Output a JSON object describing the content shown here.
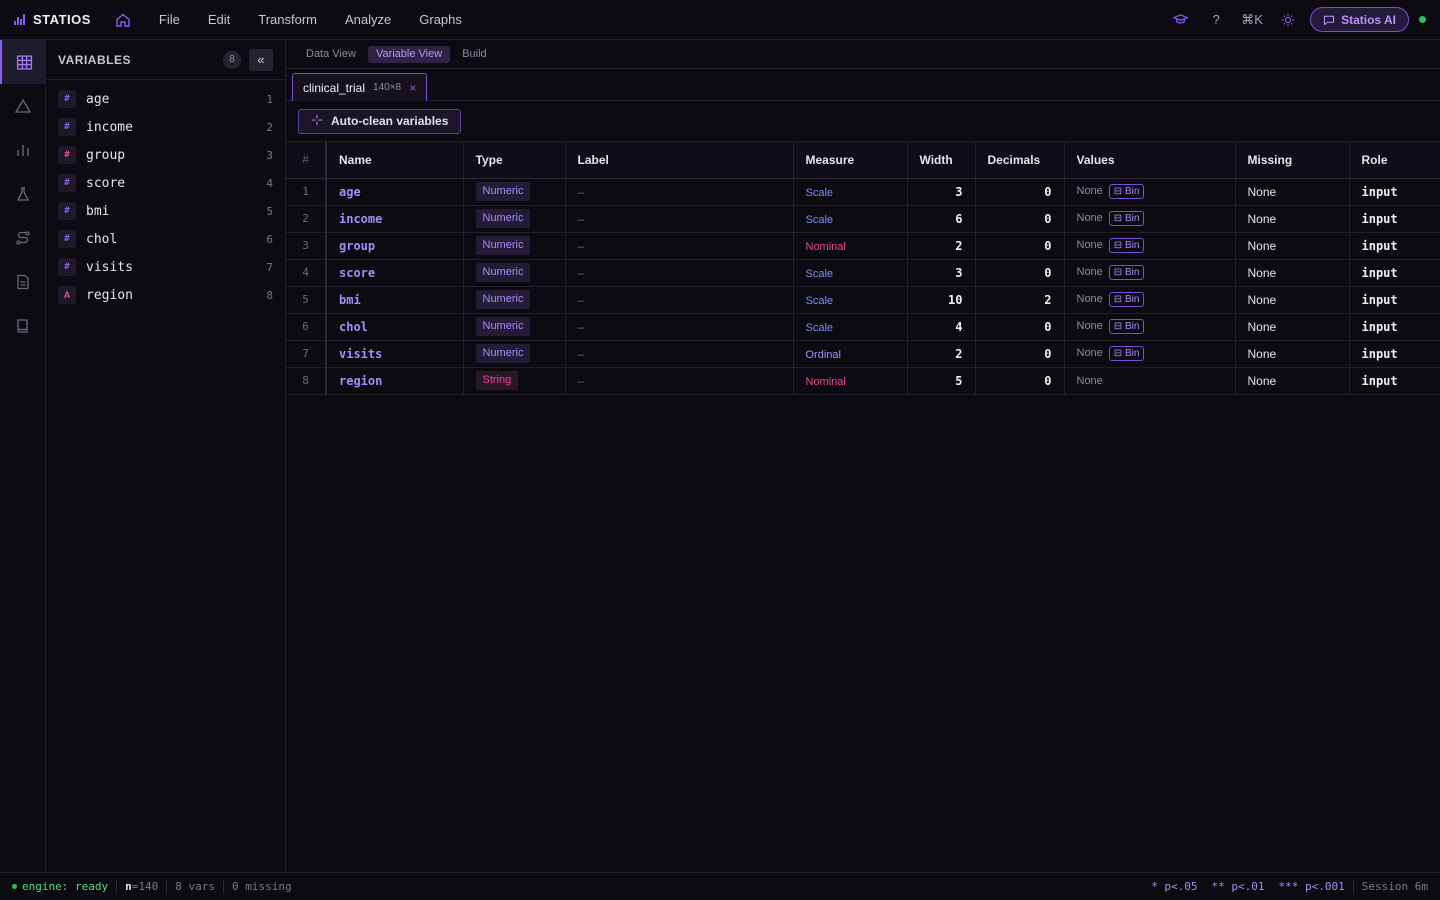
{
  "app": {
    "name": "STATIOS",
    "menu": [
      "File",
      "Edit",
      "Transform",
      "Analyze",
      "Graphs"
    ],
    "shortcut": "⌘K",
    "ai_button": "Statios AI",
    "accent": "#8b5cf6"
  },
  "rail": {
    "icons": [
      "table-icon",
      "triangle-icon",
      "bar-chart-icon",
      "flask-icon",
      "route-icon",
      "document-icon",
      "book-icon"
    ]
  },
  "sidebar": {
    "title": "VARIABLES",
    "count": "8",
    "collapse_label": "«",
    "items": [
      {
        "type": "#",
        "name": "age",
        "index": "1"
      },
      {
        "type": "#",
        "name": "income",
        "index": "2"
      },
      {
        "type": "#",
        "name": "group",
        "index": "3"
      },
      {
        "type": "#",
        "name": "score",
        "index": "4"
      },
      {
        "type": "#",
        "name": "bmi",
        "index": "5"
      },
      {
        "type": "#",
        "name": "chol",
        "index": "6"
      },
      {
        "type": "#",
        "name": "visits",
        "index": "7"
      },
      {
        "type": "A",
        "name": "region",
        "index": "8"
      }
    ]
  },
  "viewtabs": [
    "Data View",
    "Variable View",
    "Build"
  ],
  "filetab": {
    "name": "clinical_trial",
    "dims": "140×8",
    "close": "×"
  },
  "actions": {
    "autoclean": "Auto-clean variables"
  },
  "table": {
    "headers": [
      "#",
      "Name",
      "Type",
      "Label",
      "Measure",
      "Width",
      "Decimals",
      "Values",
      "Missing",
      "Role"
    ],
    "bin_label": "Bin",
    "rows": [
      {
        "idx": "1",
        "name": "age",
        "type": "Numeric",
        "label": "–",
        "measure": "Scale",
        "width": "3",
        "decimals": "0",
        "values": "None",
        "bin": true,
        "missing": "None",
        "role": "input"
      },
      {
        "idx": "2",
        "name": "income",
        "type": "Numeric",
        "label": "–",
        "measure": "Scale",
        "width": "6",
        "decimals": "0",
        "values": "None",
        "bin": true,
        "missing": "None",
        "role": "input"
      },
      {
        "idx": "3",
        "name": "group",
        "type": "Numeric",
        "label": "–",
        "measure": "Nominal",
        "width": "2",
        "decimals": "0",
        "values": "None",
        "bin": true,
        "missing": "None",
        "role": "input"
      },
      {
        "idx": "4",
        "name": "score",
        "type": "Numeric",
        "label": "–",
        "measure": "Scale",
        "width": "3",
        "decimals": "0",
        "values": "None",
        "bin": true,
        "missing": "None",
        "role": "input"
      },
      {
        "idx": "5",
        "name": "bmi",
        "type": "Numeric",
        "label": "–",
        "measure": "Scale",
        "width": "10",
        "decimals": "2",
        "values": "None",
        "bin": true,
        "missing": "None",
        "role": "input"
      },
      {
        "idx": "6",
        "name": "chol",
        "type": "Numeric",
        "label": "–",
        "measure": "Scale",
        "width": "4",
        "decimals": "0",
        "values": "None",
        "bin": true,
        "missing": "None",
        "role": "input"
      },
      {
        "idx": "7",
        "name": "visits",
        "type": "Numeric",
        "label": "–",
        "measure": "Ordinal",
        "width": "2",
        "decimals": "0",
        "values": "None",
        "bin": true,
        "missing": "None",
        "role": "input"
      },
      {
        "idx": "8",
        "name": "region",
        "type": "String",
        "label": "–",
        "measure": "Nominal",
        "width": "5",
        "decimals": "0",
        "values": "None",
        "bin": false,
        "missing": "None",
        "role": "input"
      }
    ]
  },
  "statusbar": {
    "engine": "engine: ready",
    "n_label": "n",
    "n_value": "=140",
    "vars": "8 vars",
    "missing": "0 missing",
    "sig1": "* p<.05",
    "sig2": "** p<.01",
    "sig3": "*** p<.001",
    "session": "Session 6m"
  }
}
